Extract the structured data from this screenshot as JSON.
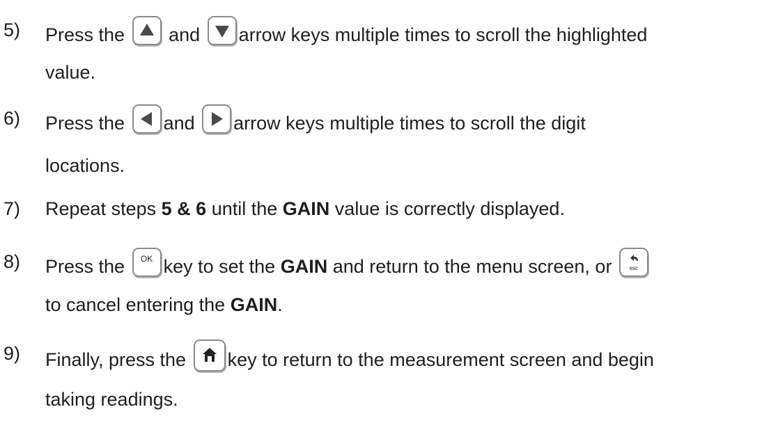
{
  "steps": [
    {
      "num": "5)",
      "parts": [
        "Press the",
        "and",
        "arrow keys multiple times to scroll the highlighted"
      ],
      "cont": "value.",
      "icons": [
        "up-arrow-icon",
        "down-arrow-icon"
      ]
    },
    {
      "num": "6)",
      "parts": [
        "Press the",
        "and",
        "arrow keys multiple times to scroll the digit"
      ],
      "cont": "locations.",
      "icons": [
        "left-arrow-icon",
        "right-arrow-icon"
      ]
    },
    {
      "num": "7)",
      "parts": [
        "Repeat steps",
        "5 & 6",
        "until the",
        "GAIN",
        "value is correctly displayed."
      ]
    },
    {
      "num": "8)",
      "parts": [
        "Press the",
        "key to set the",
        "GAIN",
        "and return to the menu screen, or"
      ],
      "cont_parts": [
        "to cancel entering the",
        "GAIN",
        "."
      ],
      "icons": [
        "ok-key-icon",
        "esc-key-icon"
      ],
      "ok_key_label": "OK",
      "esc_key_label": "esc"
    },
    {
      "num": "9)",
      "parts": [
        "Finally, press the",
        "key to return to the measurement screen and begin"
      ],
      "cont": "taking readings.",
      "icons": [
        "home-key-icon"
      ]
    }
  ]
}
